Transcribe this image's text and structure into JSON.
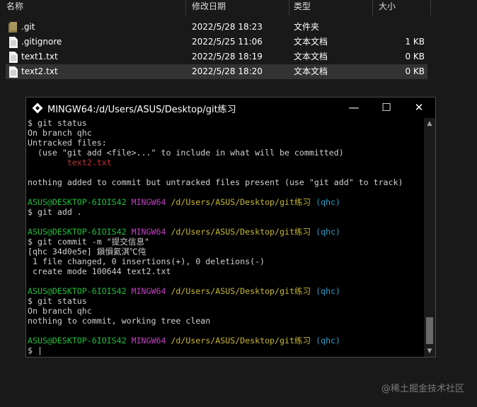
{
  "explorer": {
    "columns": {
      "name": "名称",
      "modified": "修改日期",
      "type": "类型",
      "size": "大小"
    },
    "collapse_glyph": "^",
    "files": [
      {
        "icon": "folder-icon",
        "name": ".git",
        "modified": "2022/5/28 18:23",
        "type": "文件夹",
        "size": ""
      },
      {
        "icon": "file-icon",
        "name": ".gitignore",
        "modified": "2022/5/25 11:06",
        "type": "文本文档",
        "size": "1 KB"
      },
      {
        "icon": "file-icon",
        "name": "text1.txt",
        "modified": "2022/5/28 18:19",
        "type": "文本文档",
        "size": "0 KB"
      },
      {
        "icon": "file-icon",
        "name": "text2.txt",
        "modified": "2022/5/28 18:20",
        "type": "文本文档",
        "size": "0 KB"
      }
    ]
  },
  "terminal": {
    "title": "MINGW64:/d/Users/ASUS/Desktop/git练习",
    "buttons": {
      "minimize": "—",
      "maximize": "☐",
      "close": "✕"
    },
    "prompt": {
      "user": "ASUS@DESKTOP-6IOIS42",
      "env": "MINGW64",
      "path": "/d/Users/ASUS/Desktop/git练习",
      "branch": "(qhc)"
    },
    "lines": {
      "l1": "$ git status",
      "l2": "On branch qhc",
      "l3": "Untracked files:",
      "l4": "  (use \"git add <file>...\" to include in what will be committed)",
      "l5": "        text2.txt",
      "l6": "",
      "l7": "nothing added to commit but untracked files present (use \"git add\" to track)",
      "l8": "",
      "l10": "$ git add .",
      "l11": "",
      "l13": "$ git commit -m \"提交信息\"",
      "l14": "[qhc 34d0e5e] 鎻愪氦淇℃伅",
      "l15": " 1 file changed, 0 insertions(+), 0 deletions(-)",
      "l16": " create mode 100644 text2.txt",
      "l17": "",
      "l19": "$ git status",
      "l20": "On branch qhc",
      "l21": "nothing to commit, working tree clean",
      "l22": "",
      "l24": "$ |"
    }
  },
  "watermark": "@稀土掘金技术社区",
  "colors": {
    "prompt_user": "#1fbf3a",
    "prompt_env": "#c040c0",
    "prompt_path": "#c8b832",
    "prompt_branch": "#2aa0c8",
    "untracked": "#c23131"
  }
}
